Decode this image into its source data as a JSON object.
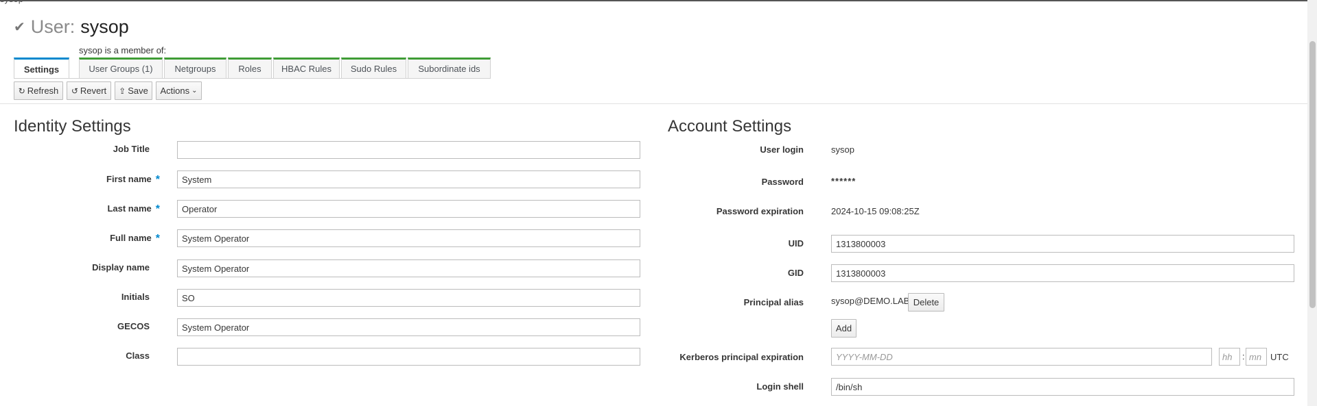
{
  "header": {
    "crumb": "sysop",
    "entity_type": "User:",
    "entity_name": "sysop",
    "member_of_label": "sysop is a member of:"
  },
  "tabs": [
    {
      "label": "Settings"
    },
    {
      "label": "User Groups (1)"
    },
    {
      "label": "Netgroups"
    },
    {
      "label": "Roles"
    },
    {
      "label": "HBAC Rules"
    },
    {
      "label": "Sudo Rules"
    },
    {
      "label": "Subordinate ids"
    }
  ],
  "toolbar": {
    "refresh": "Refresh",
    "revert": "Revert",
    "save": "Save",
    "actions": "Actions"
  },
  "identity": {
    "title": "Identity Settings",
    "fields": [
      {
        "label": "Job Title",
        "value": "",
        "required": false
      },
      {
        "label": "First name",
        "value": "System",
        "required": true
      },
      {
        "label": "Last name",
        "value": "Operator",
        "required": true
      },
      {
        "label": "Full name",
        "value": "System Operator",
        "required": true
      },
      {
        "label": "Display name",
        "value": "System Operator",
        "required": false
      },
      {
        "label": "Initials",
        "value": "SO",
        "required": false
      },
      {
        "label": "GECOS",
        "value": "System Operator",
        "required": false
      },
      {
        "label": "Class",
        "value": "",
        "required": false
      }
    ],
    "required_marker": "*"
  },
  "account": {
    "title": "Account Settings",
    "user_login_label": "User login",
    "user_login": "sysop",
    "password_label": "Password",
    "password": "******",
    "password_expiration_label": "Password expiration",
    "password_expiration": "2024-10-15 09:08:25Z",
    "uid_label": "UID",
    "uid": "1313800003",
    "gid_label": "GID",
    "gid": "1313800003",
    "principal_alias_label": "Principal alias",
    "principal_alias": "sysop@DEMO.LABS",
    "delete_label": "Delete",
    "add_label": "Add",
    "krb_exp_label": "Kerberos principal expiration",
    "date_placeholder": "YYYY-MM-DD",
    "hour_placeholder": "hh",
    "time_sep": ":",
    "minute_placeholder": "mn",
    "utc": "UTC",
    "login_shell_label": "Login shell",
    "login_shell": "/bin/sh"
  },
  "colors": {
    "accent_blue": "#0088ce",
    "tab_green": "#3f9c35"
  }
}
